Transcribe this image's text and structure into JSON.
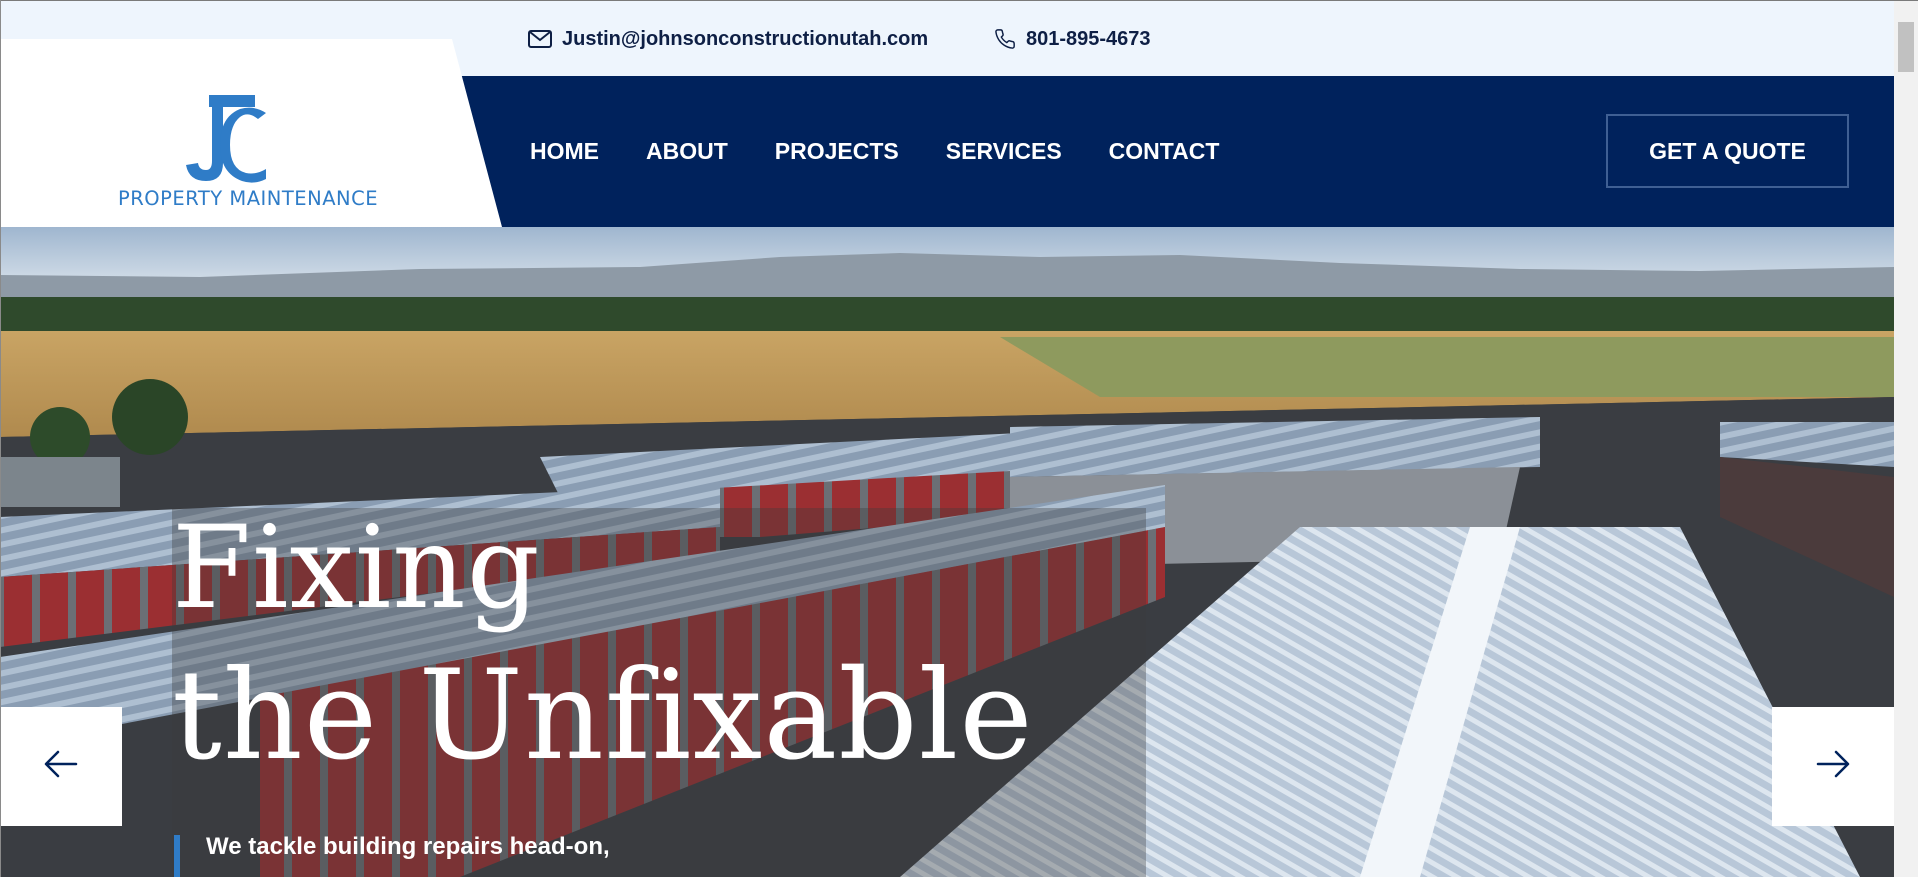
{
  "topbar": {
    "email": "Justin@johnsonconstructionutah.com",
    "phone": "801-895-4673",
    "icons": {
      "email": "envelope-icon",
      "phone": "phone-icon"
    }
  },
  "logo": {
    "monogram": "JC",
    "text": "PROPERTY MAINTENANCE"
  },
  "nav": {
    "items": [
      "HOME",
      "ABOUT",
      "PROJECTS",
      "SERVICES",
      "CONTACT"
    ],
    "cta": "GET A QUOTE"
  },
  "hero": {
    "title_line1": "Fixing",
    "title_line2": "the Unfixable",
    "subtitle": "We tackle building repairs head-on,",
    "prev_icon": "arrow-left-icon",
    "next_icon": "arrow-right-icon"
  },
  "colors": {
    "navy": "#00225c",
    "topbar_bg": "#eef5fd",
    "brand_blue": "#2f7cc7",
    "text_dark": "#0e1f45"
  }
}
